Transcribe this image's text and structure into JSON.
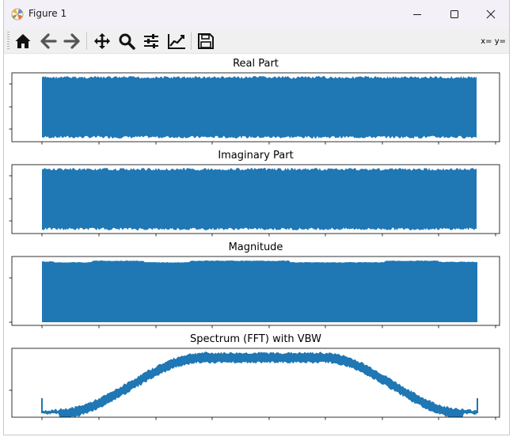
{
  "window": {
    "title": "Figure 1",
    "icon": "matplotlib-icon",
    "controls": [
      "minimize-icon",
      "maximize-icon",
      "close-icon"
    ]
  },
  "toolbar": {
    "buttons": [
      {
        "name": "home",
        "icon": "home-icon"
      },
      {
        "name": "back",
        "icon": "arrow-left-icon"
      },
      {
        "name": "forward",
        "icon": "arrow-right-icon"
      },
      {
        "name": "pan",
        "icon": "move-icon"
      },
      {
        "name": "zoom",
        "icon": "magnifier-icon"
      },
      {
        "name": "subplots",
        "icon": "sliders-icon"
      },
      {
        "name": "customize",
        "icon": "line-chart-icon"
      },
      {
        "name": "save",
        "icon": "floppy-disk-icon"
      }
    ],
    "coords": "x= y="
  },
  "colors": {
    "series": "#1f77b4",
    "titlebar": "#f3f0f7",
    "toolbar": "#f0f0f0"
  },
  "chart_data": [
    {
      "type": "line",
      "title": "Real Part",
      "description_shape": "dense oscillation filling symmetric band",
      "band": {
        "upper": 0.9,
        "lower": -0.9
      },
      "grid": false
    },
    {
      "type": "line",
      "title": "Imaginary Part",
      "description_shape": "dense oscillation filling symmetric band",
      "band": {
        "upper": 0.9,
        "lower": -0.9
      },
      "grid": false
    },
    {
      "type": "line",
      "title": "Magnitude",
      "band": {
        "upper": 1.0,
        "lower": 0.0
      },
      "grid": false
    },
    {
      "type": "line",
      "title": "Spectrum (FFT) with VBW",
      "envelope_shape": "trapezoidal rise, flat plateau, symmetric fall",
      "grid": false
    }
  ]
}
